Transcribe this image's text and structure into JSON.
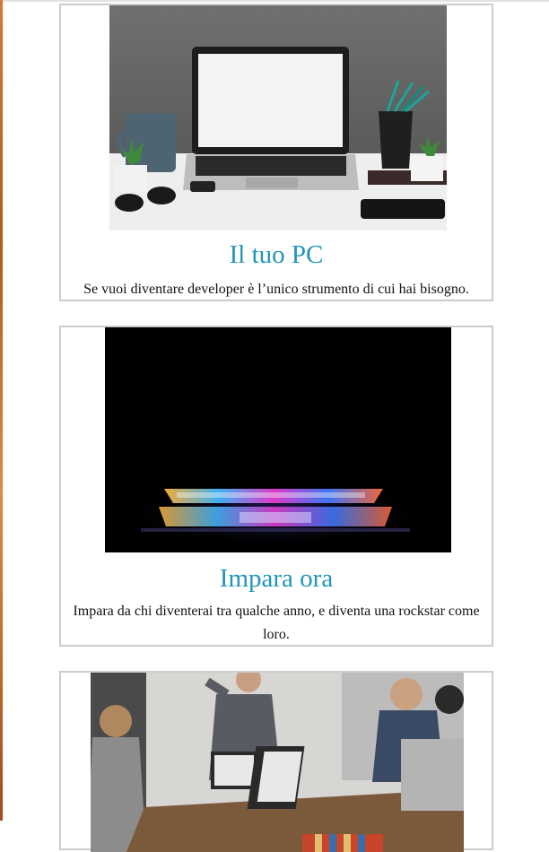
{
  "cards": [
    {
      "title": "Il tuo PC",
      "text": "Se vuoi diventare developer è l’unico strumento di cui hai bisogno.",
      "image": "laptop-on-desk-photo"
    },
    {
      "title": "Impara ora",
      "text": "Impara da chi diventerai tra qualche anno, e diventa una rockstar come loro.",
      "image": "glowing-laptop-photo"
    },
    {
      "title": "",
      "text": "",
      "image": "team-meeting-photo"
    }
  ],
  "colors": {
    "heading": "#2196b8",
    "card_border": "#cccccc",
    "left_strip": "#d9772e"
  }
}
